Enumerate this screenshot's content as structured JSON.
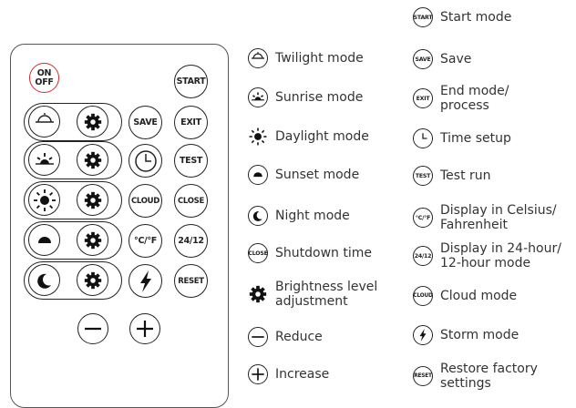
{
  "remote": {
    "buttons": {
      "on_off_line1": "ON",
      "on_off_line2": "OFF",
      "start": "START",
      "save": "SAVE",
      "exit": "EXIT",
      "test": "TEST",
      "cloud": "CLOUD",
      "close": "CLOSE",
      "celsius_fahrenheit": "°C/°F",
      "hour_format": "24/12",
      "reset": "RESET"
    },
    "accent_color": "#d9262b"
  },
  "legend_left": [
    {
      "icon": "twilight-icon",
      "text": "Twilight mode"
    },
    {
      "icon": "sunrise-icon",
      "text": "Sunrise mode"
    },
    {
      "icon": "daylight-icon",
      "text": "Daylight mode"
    },
    {
      "icon": "sunset-icon",
      "text": "Sunset mode"
    },
    {
      "icon": "night-icon",
      "text": "Night mode"
    },
    {
      "icon": "close-icon",
      "icon_label": "CLOSE",
      "text": "Shutdown time"
    },
    {
      "icon": "gear-icon",
      "text": "Brightness level\nadjustment"
    },
    {
      "icon": "minus-icon",
      "text": "Reduce"
    },
    {
      "icon": "plus-icon",
      "text": "Increase"
    }
  ],
  "legend_right": [
    {
      "icon": "start-icon",
      "icon_label": "START",
      "text": "Start mode"
    },
    {
      "icon": "save-icon",
      "icon_label": "SAVE",
      "text": "Save"
    },
    {
      "icon": "exit-icon",
      "icon_label": "EXIT",
      "text": "End mode/\nprocess"
    },
    {
      "icon": "clock-icon",
      "text": "Time setup"
    },
    {
      "icon": "test-icon",
      "icon_label": "TEST",
      "text": "Test run"
    },
    {
      "icon": "celsius-icon",
      "icon_label": "°C/°F",
      "text": "Display in Celsius/\nFahrenheit"
    },
    {
      "icon": "hour-format-icon",
      "icon_label": "24/12",
      "text": "Display in 24-hour/\n12-hour mode"
    },
    {
      "icon": "cloud-icon",
      "icon_label": "CLOUD",
      "text": "Cloud mode"
    },
    {
      "icon": "lightning-icon",
      "text": "Storm mode"
    },
    {
      "icon": "reset-icon",
      "icon_label": "RESET",
      "text": "Restore factory\nsettings"
    }
  ]
}
